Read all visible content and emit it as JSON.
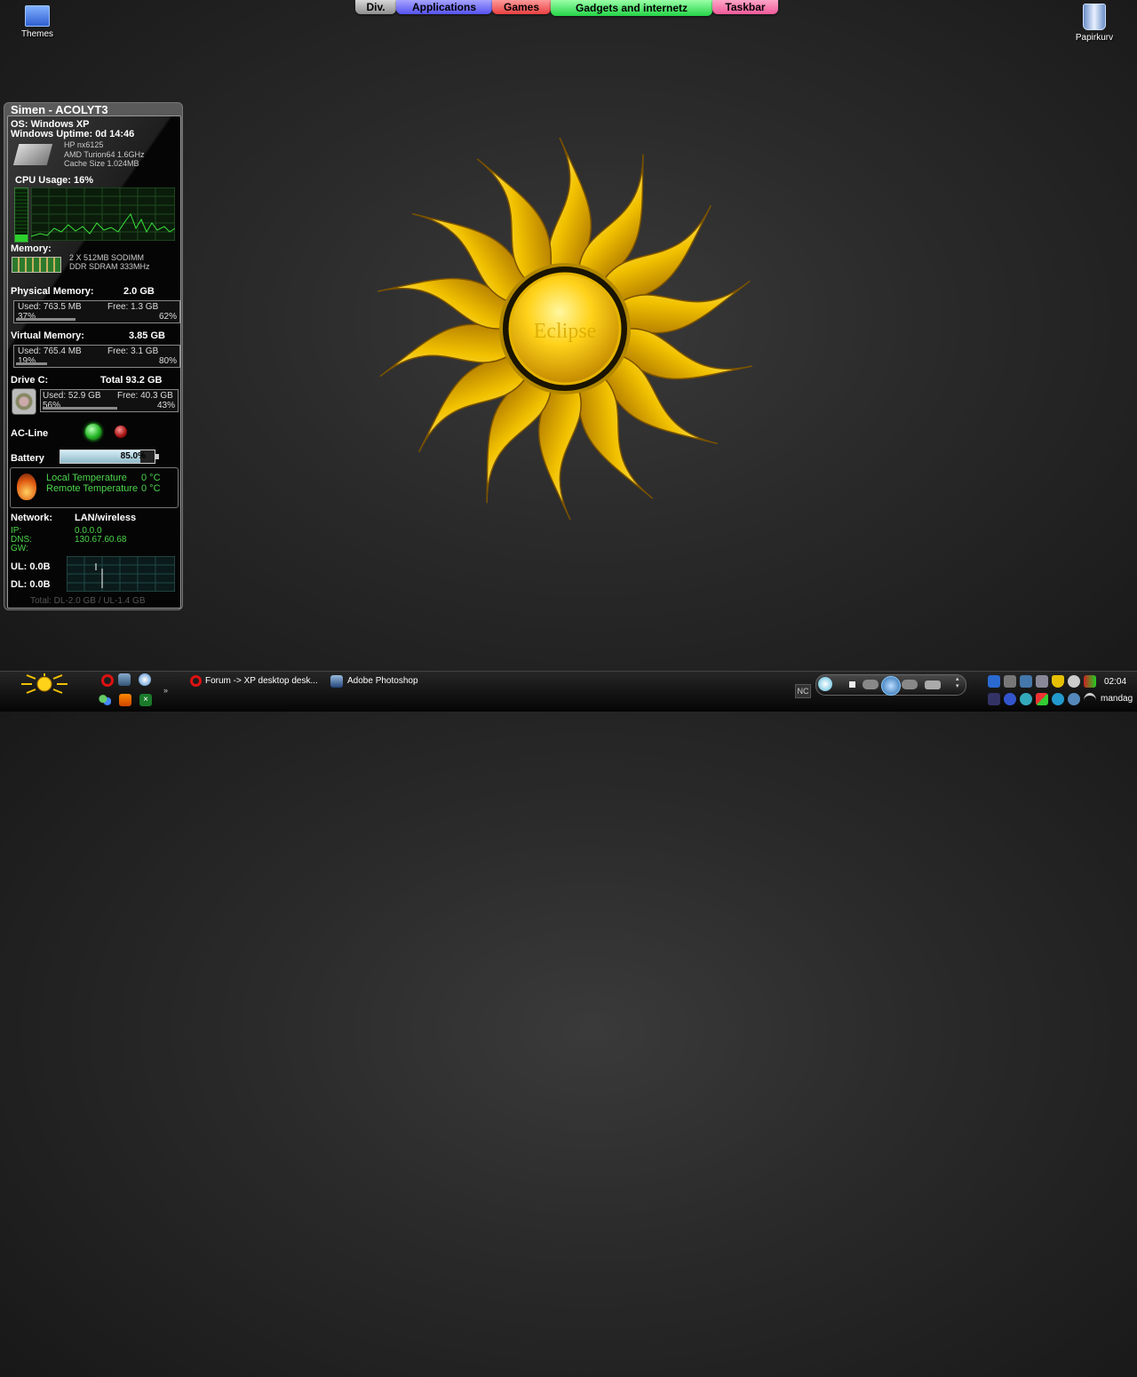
{
  "desktop": {
    "themes_label": "Themes",
    "recycle_label": "Papirkurv",
    "wallpaper_text": "Eclipse"
  },
  "launcher_tabs": [
    {
      "label": "Div.",
      "color": "#9a9a9a"
    },
    {
      "label": "Applications",
      "color": "#6f6cf5"
    },
    {
      "label": "Games",
      "color": "#f05a5a"
    },
    {
      "label": "Gadgets and internetz",
      "color": "#3de05a"
    },
    {
      "label": "Taskbar",
      "color": "#f06aa0"
    }
  ],
  "sysinfo": {
    "title": "Simen - ACOLYT3",
    "os": "OS:  Windows XP",
    "uptime": "Windows Uptime: 0d 14:46",
    "cpu_model": "HP nx6125",
    "cpu_name": "AMD Turion64 1.6GHz",
    "cpu_cache": "Cache Size 1.024MB",
    "cpu_usage": "CPU Usage: 16%",
    "memory_label": "Memory:",
    "memory_line1": "2 X 512MB SODIMM",
    "memory_line2": "DDR SDRAM 333MHz",
    "physical": {
      "label": "Physical Memory:",
      "total": "2.0 GB",
      "used": "Used: 763.5 MB",
      "free": "Free: 1.3 GB",
      "used_pct": "37%",
      "free_pct": "62%",
      "fill": 0.37
    },
    "virtual": {
      "label": "Virtual Memory:",
      "total": "3.85 GB",
      "used": "Used: 765.4 MB",
      "free": "Free: 3.1 GB",
      "used_pct": "19%",
      "free_pct": "80%",
      "fill": 0.19
    },
    "drive": {
      "label": "Drive C:",
      "total": "Total 93.2 GB",
      "used": "Used: 52.9 GB",
      "free": "Free: 40.3 GB",
      "used_pct": "56%",
      "free_pct": "43%",
      "fill": 0.56
    },
    "acline_label": "AC-Line",
    "battery_label": "Battery",
    "battery_value": "85.0%",
    "battery_fill": 0.85,
    "local_temp_label": "Local Temperature",
    "local_temp_value": "0 °C",
    "remote_temp_label": "Remote Temperature",
    "remote_temp_value": "0 °C",
    "network_label": "Network:",
    "network_type": "LAN/wireless",
    "ip_label": "IP:",
    "ip_value": "0.0.0.0",
    "dns_label": "DNS:",
    "dns_value": "130.67.60.68",
    "gw_label": "GW:",
    "ul_label": "UL: 0.0B",
    "dl_label": "DL: 0.0B",
    "total_traffic": "Total: DL-2.0 GB / UL-1.4 GB"
  },
  "taskbar": {
    "window1": "Forum -> XP desktop desk...",
    "window2": "Adobe Photoshop",
    "nc_label": "NC",
    "clock": "02:04",
    "day": "mandag"
  }
}
